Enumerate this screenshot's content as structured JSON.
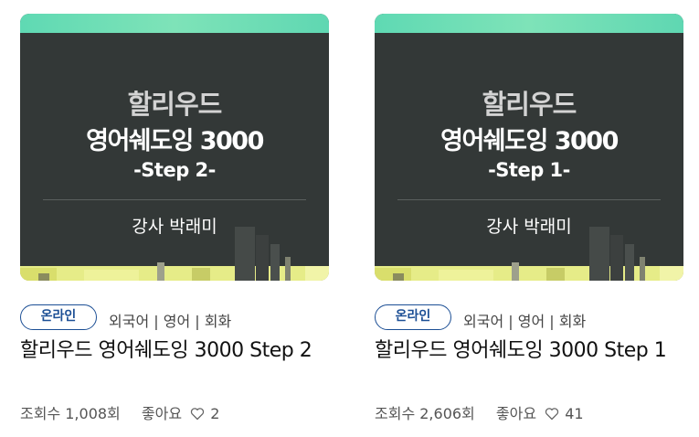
{
  "cards": [
    {
      "thumb": {
        "line1": "할리우드",
        "line2": "영어쉐도잉 3000",
        "line3": "-Step 2-",
        "teacher": "강사 박래미"
      },
      "badge": "온라인",
      "category": "외국어 | 영어 | 회화",
      "title": "할리우드 영어쉐도잉 3000 Step 2",
      "views": "조회수 1,008회",
      "likes_label": "좋아요",
      "likes_count": "2"
    },
    {
      "thumb": {
        "line1": "할리우드",
        "line2": "영어쉐도잉 3000",
        "line3": "-Step 1-",
        "teacher": "강사 박래미"
      },
      "badge": "온라인",
      "category": "외국어 | 영어 | 회화",
      "title": "할리우드 영어쉐도잉 3000 Step 1",
      "views": "조회수 2,606회",
      "likes_label": "좋아요",
      "likes_count": "41"
    }
  ],
  "colors": {
    "accent_teal": "#5fd9b3",
    "thumb_bg": "#333837",
    "badge_blue": "#1c4f95",
    "city_yellow": "#e6ec88"
  }
}
